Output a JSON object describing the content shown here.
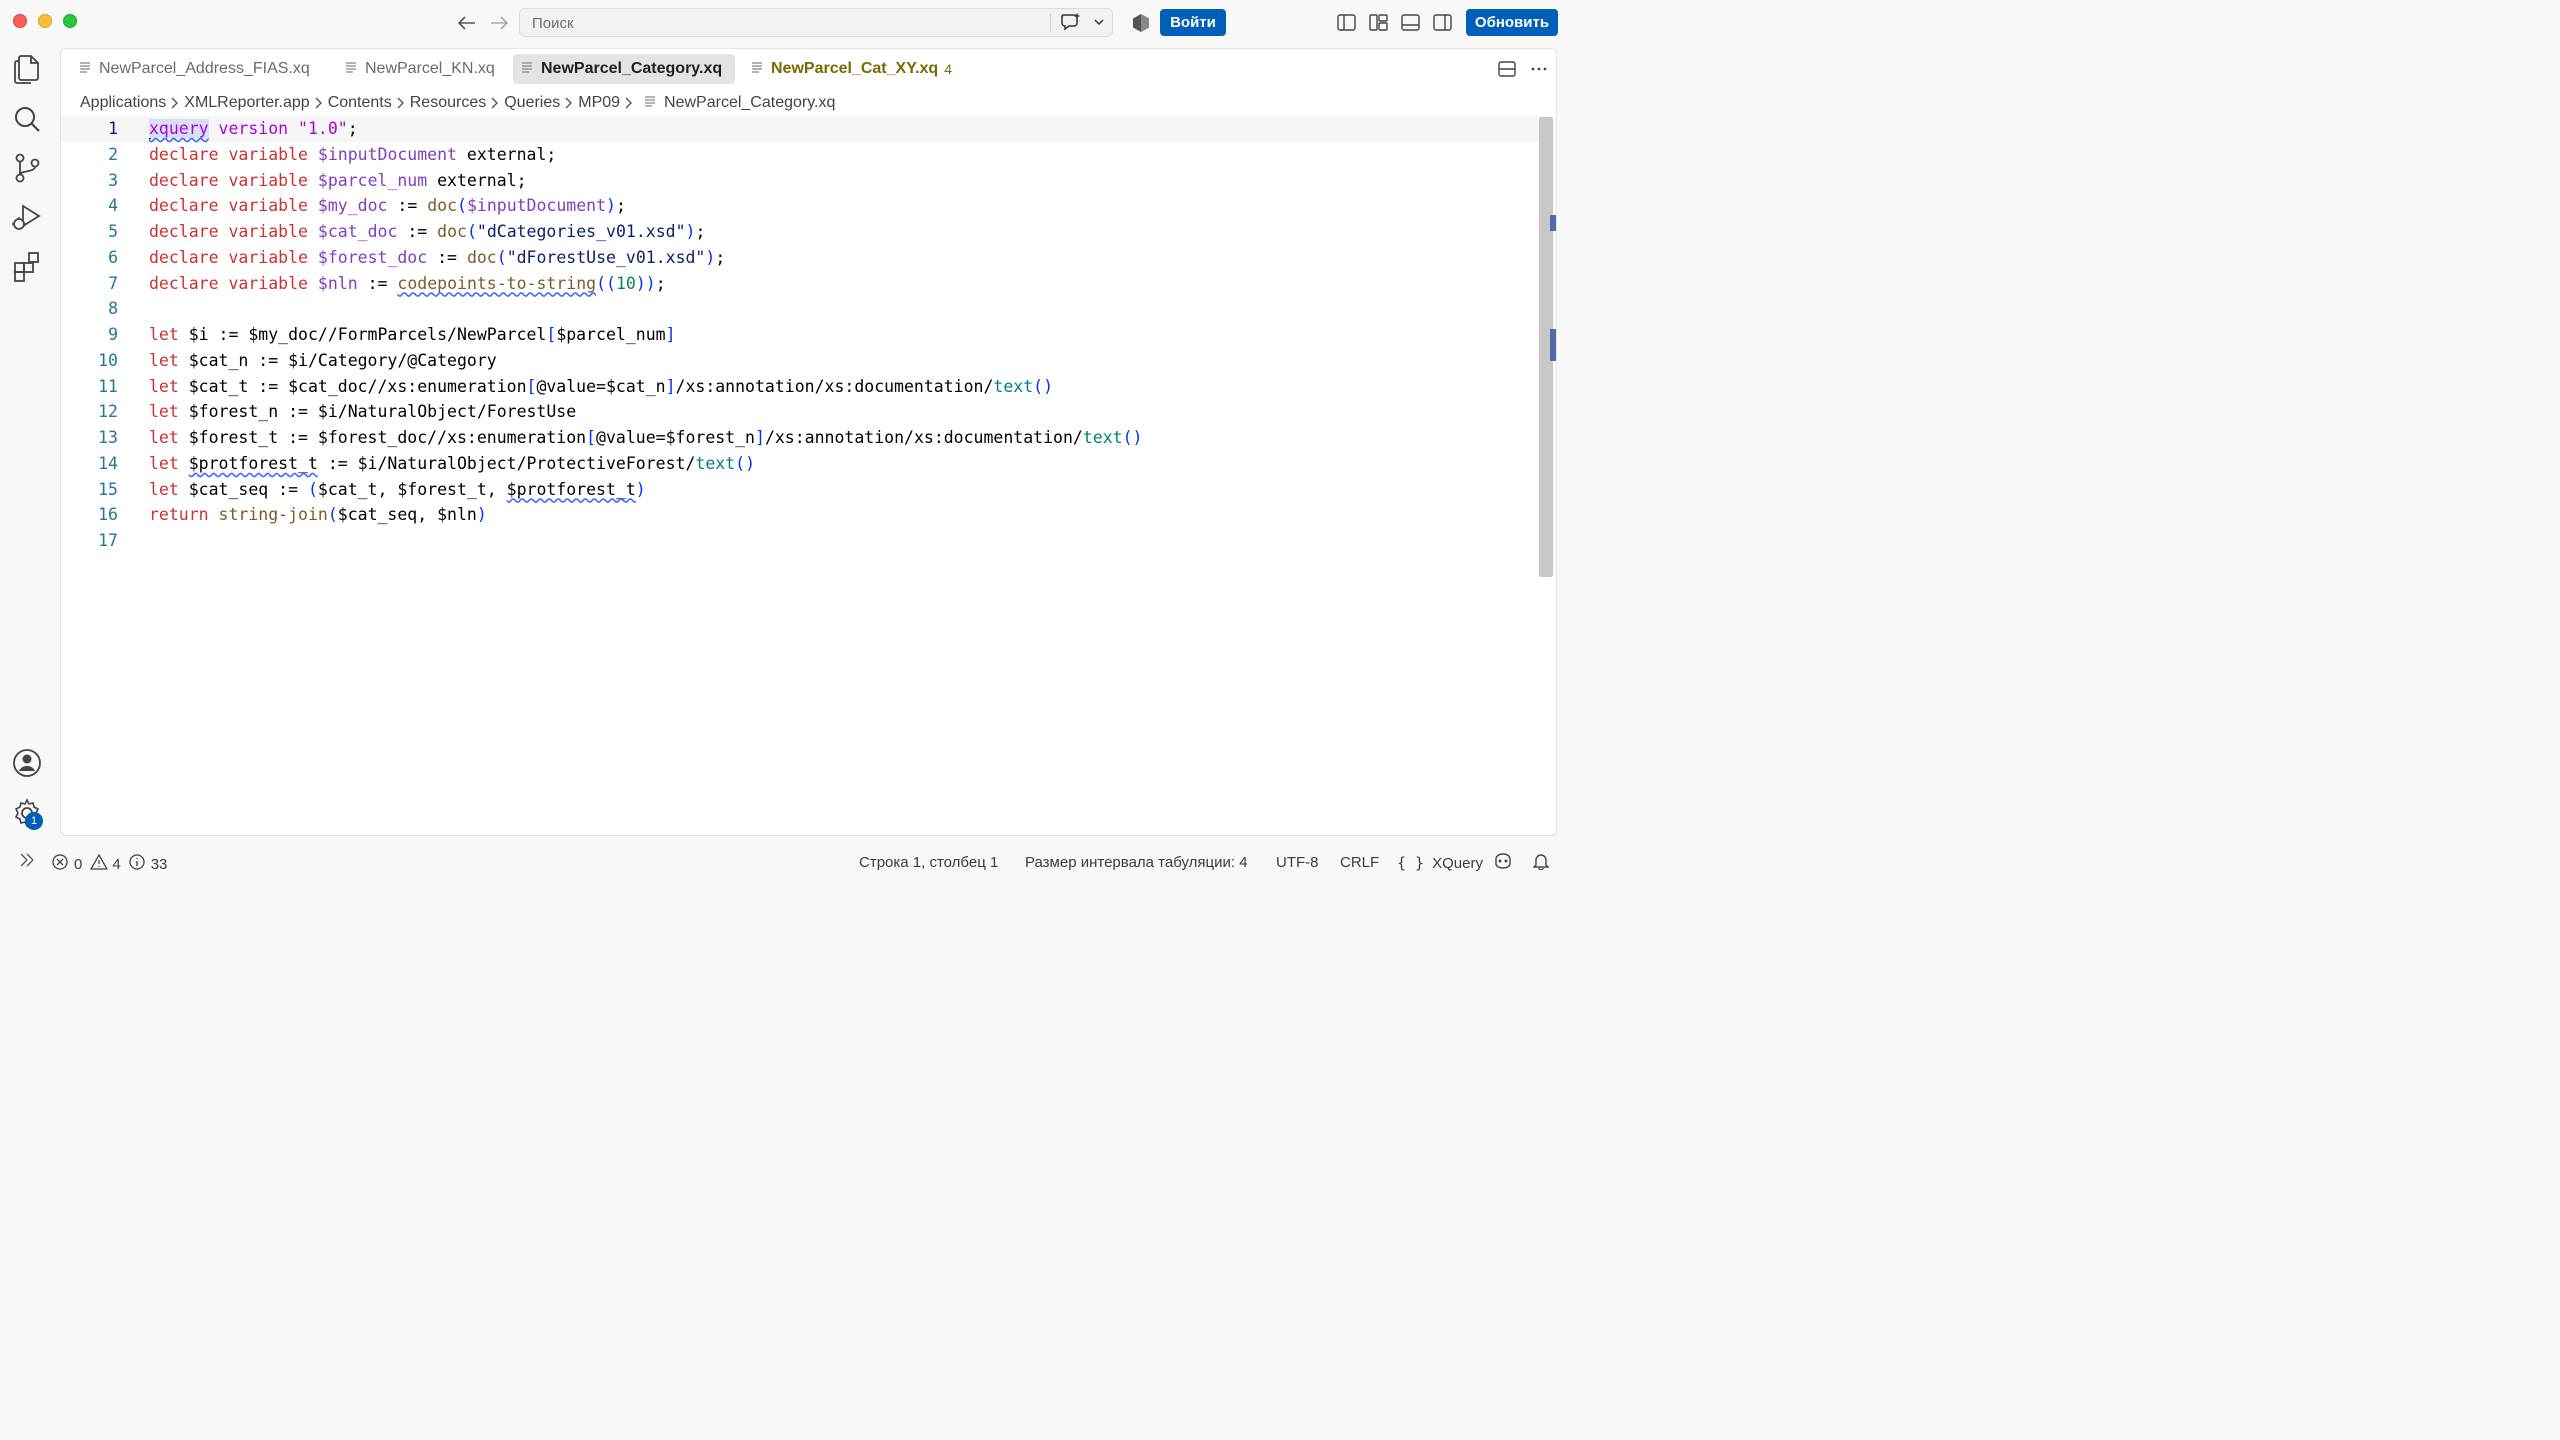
{
  "titlebar": {
    "search_placeholder": "Поиск",
    "login_label": "Войти",
    "update_label": "Обновить"
  },
  "tabs": [
    {
      "label": "NewParcel_Address_FIAS.xq"
    },
    {
      "label": "NewParcel_KN.xq"
    },
    {
      "label": "NewParcel_Category.xq",
      "active": true
    },
    {
      "label": "NewParcel_Cat_XY.xq",
      "problems": "4"
    }
  ],
  "breadcrumb": [
    "Applications",
    "XMLReporter.app",
    "Contents",
    "Resources",
    "Queries",
    "MP09",
    "NewParcel_Category.xq"
  ],
  "code": {
    "line_numbers": [
      "1",
      "2",
      "3",
      "4",
      "5",
      "6",
      "7",
      "8",
      "9",
      "10",
      "11",
      "12",
      "13",
      "14",
      "15",
      "16",
      "17"
    ],
    "lines": [
      "xquery version \"1.0\";",
      "declare variable $inputDocument external;",
      "declare variable $parcel_num external;",
      "declare variable $my_doc := doc($inputDocument);",
      "declare variable $cat_doc := doc(\"dCategories_v01.xsd\");",
      "declare variable $forest_doc := doc(\"dForestUse_v01.xsd\");",
      "declare variable $nln := codepoints-to-string((10));",
      "",
      "let $i := $my_doc//FormParcels/NewParcel[$parcel_num]",
      "let $cat_n := $i/Category/@Category",
      "let $cat_t := $cat_doc//xs:enumeration[@value=$cat_n]/xs:annotation/xs:documentation/text()",
      "let $forest_n := $i/NaturalObject/ForestUse",
      "let $forest_t := $forest_doc//xs:enumeration[@value=$forest_n]/xs:annotation/xs:documentation/text()",
      "let $protforest_t := $i/NaturalObject/ProtectiveForest/text()",
      "let $cat_seq := ($cat_t, $forest_t, $protforest_t)",
      "return string-join($cat_seq, $nln)",
      ""
    ]
  },
  "statusbar": {
    "errors": "0",
    "warnings": "4",
    "infos": "33",
    "position": "Строка 1, столбец 1",
    "tab_size": "Размер интервала табуляции: 4",
    "encoding": "UTF-8",
    "eol": "CRLF",
    "language": "XQuery"
  },
  "activity": {
    "settings_badge": "1"
  },
  "colors": {
    "accent": "#005fb8",
    "keyword": "#cd3131",
    "variable": "#7f3fbf",
    "string": "#0b216f",
    "function": "#795e26",
    "number": "#098658",
    "line_number": "#237893"
  },
  "icons": [
    "back-arrow-icon",
    "forward-arrow-icon",
    "chat-sparkle-icon",
    "chevron-down-icon",
    "copilot-icon",
    "toggle-primary-sidebar-icon",
    "customize-layout-icon",
    "toggle-panel-icon",
    "toggle-secondary-sidebar-icon",
    "files-icon",
    "search-icon",
    "source-control-icon",
    "run-debug-icon",
    "extensions-icon",
    "accounts-icon",
    "manage-gear-icon",
    "split-editor-icon",
    "more-actions-icon",
    "remote-icon",
    "error-icon",
    "warning-icon",
    "info-icon",
    "braces-icon",
    "copilot-status-icon",
    "bell-icon"
  ]
}
